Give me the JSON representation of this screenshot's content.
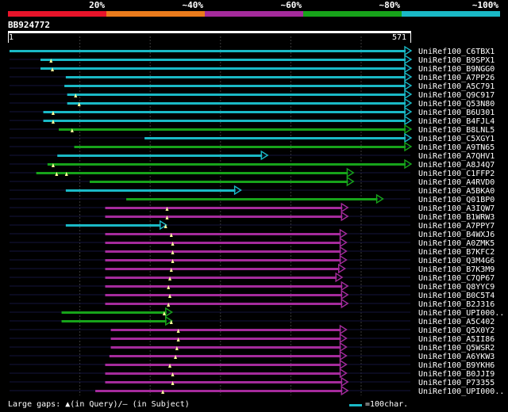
{
  "legend": {
    "segments": [
      {
        "color": "#e8142a",
        "label": "20%"
      },
      {
        "color": "#ea7b1c",
        "label": "~40%"
      },
      {
        "color": "#a52b9c",
        "label": "~60%"
      },
      {
        "color": "#17a31a",
        "label": "~80%"
      },
      {
        "color": "#1ab9c6",
        "label": "~100%"
      }
    ]
  },
  "query": {
    "id": "BB924772",
    "start": "1",
    "end": "571",
    "length": 571
  },
  "colors": {
    "cyan": "#1ab9c6",
    "green": "#17a31a",
    "magenta": "#a52b9c",
    "row_guide": "#14143c",
    "grid": "#3c3c3c",
    "gap_marker": "#ffff99"
  },
  "hits": [
    {
      "name": "UniRef100_C6TBX1",
      "start": 1,
      "end": 571,
      "color": "cyan",
      "markers": []
    },
    {
      "name": "UniRef100_B9SPX1",
      "start": 45,
      "end": 571,
      "color": "cyan",
      "markers": [
        60
      ]
    },
    {
      "name": "UniRef100_B9NGG0",
      "start": 45,
      "end": 571,
      "color": "cyan",
      "markers": [
        62
      ]
    },
    {
      "name": "UniRef100_A7PP26",
      "start": 81,
      "end": 571,
      "color": "cyan",
      "markers": []
    },
    {
      "name": "UniRef100_A5C791",
      "start": 79,
      "end": 571,
      "color": "cyan",
      "markers": []
    },
    {
      "name": "UniRef100_Q9C917",
      "start": 83,
      "end": 571,
      "color": "cyan",
      "markers": [
        95
      ]
    },
    {
      "name": "UniRef100_Q53N80",
      "start": 83,
      "end": 571,
      "color": "cyan",
      "markers": [
        100
      ]
    },
    {
      "name": "UniRef100_B6U301",
      "start": 49,
      "end": 571,
      "color": "cyan",
      "markers": [
        63
      ]
    },
    {
      "name": "UniRef100_B4FJL4",
      "start": 49,
      "end": 571,
      "color": "cyan",
      "markers": [
        63
      ]
    },
    {
      "name": "UniRef100_B8LNL5",
      "start": 71,
      "end": 571,
      "color": "green",
      "markers": [
        90
      ]
    },
    {
      "name": "UniRef100_C5XGY1",
      "start": 193,
      "end": 571,
      "color": "cyan",
      "markers": []
    },
    {
      "name": "UniRef100_A9TN65",
      "start": 93,
      "end": 571,
      "color": "green",
      "markers": []
    },
    {
      "name": "UniRef100_A7QHV1",
      "start": 69,
      "end": 367,
      "color": "cyan",
      "markers": []
    },
    {
      "name": "UniRef100_A8J4Q7",
      "start": 55,
      "end": 571,
      "color": "green",
      "markers": [
        63
      ]
    },
    {
      "name": "UniRef100_C1FFP2",
      "start": 39,
      "end": 489,
      "color": "green",
      "markers": [
        68,
        82
      ]
    },
    {
      "name": "UniRef100_A4RVD0",
      "start": 115,
      "end": 489,
      "color": "green",
      "markers": []
    },
    {
      "name": "UniRef100_A5BKA0",
      "start": 81,
      "end": 329,
      "color": "cyan",
      "markers": []
    },
    {
      "name": "UniRef100_Q01BP0",
      "start": 167,
      "end": 531,
      "color": "green",
      "markers": []
    },
    {
      "name": "UniRef100_A3IQW7",
      "start": 137,
      "end": 481,
      "color": "magenta",
      "markers": [
        225
      ]
    },
    {
      "name": "UniRef100_B1WRW3",
      "start": 137,
      "end": 481,
      "color": "magenta",
      "markers": [
        225
      ]
    },
    {
      "name": "UniRef100_A7PPY7",
      "start": 81,
      "end": 223,
      "color": "cyan",
      "markers": [
        223
      ]
    },
    {
      "name": "UniRef100_B4WXJ6",
      "start": 137,
      "end": 479,
      "color": "magenta",
      "markers": [
        231
      ]
    },
    {
      "name": "UniRef100_A0ZMK5",
      "start": 137,
      "end": 479,
      "color": "magenta",
      "markers": [
        233
      ]
    },
    {
      "name": "UniRef100_B7KFC2",
      "start": 137,
      "end": 479,
      "color": "magenta",
      "markers": [
        233
      ]
    },
    {
      "name": "UniRef100_Q3M4G6",
      "start": 137,
      "end": 479,
      "color": "magenta",
      "markers": [
        233
      ]
    },
    {
      "name": "UniRef100_B7K3M9",
      "start": 137,
      "end": 477,
      "color": "magenta",
      "markers": [
        231
      ]
    },
    {
      "name": "UniRef100_C7QP67",
      "start": 137,
      "end": 473,
      "color": "magenta",
      "markers": [
        229
      ]
    },
    {
      "name": "UniRef100_Q8YYC9",
      "start": 137,
      "end": 481,
      "color": "magenta",
      "markers": [
        227
      ]
    },
    {
      "name": "UniRef100_B0C5T4",
      "start": 137,
      "end": 481,
      "color": "magenta",
      "markers": [
        229
      ]
    },
    {
      "name": "UniRef100_B2J316",
      "start": 137,
      "end": 481,
      "color": "magenta",
      "markers": [
        227
      ]
    },
    {
      "name": "UniRef100_UPI000..",
      "start": 75,
      "end": 231,
      "color": "green",
      "markers": [
        221
      ]
    },
    {
      "name": "UniRef100_A5C402",
      "start": 75,
      "end": 231,
      "color": "green",
      "markers": [
        231
      ]
    },
    {
      "name": "UniRef100_Q5X0Y2",
      "start": 145,
      "end": 479,
      "color": "magenta",
      "markers": [
        241
      ]
    },
    {
      "name": "UniRef100_A5II86",
      "start": 145,
      "end": 479,
      "color": "magenta",
      "markers": [
        241
      ]
    },
    {
      "name": "UniRef100_Q5WSR2",
      "start": 145,
      "end": 479,
      "color": "magenta",
      "markers": [
        239
      ]
    },
    {
      "name": "UniRef100_A6YKW3",
      "start": 143,
      "end": 479,
      "color": "magenta",
      "markers": [
        237
      ]
    },
    {
      "name": "UniRef100_B9YKH6",
      "start": 137,
      "end": 479,
      "color": "magenta",
      "markers": [
        229
      ]
    },
    {
      "name": "UniRef100_B0JJI9",
      "start": 137,
      "end": 479,
      "color": "magenta",
      "markers": [
        233
      ]
    },
    {
      "name": "UniRef100_P73355",
      "start": 137,
      "end": 481,
      "color": "magenta",
      "markers": [
        233
      ]
    },
    {
      "name": "UniRef100_UPI000..",
      "start": 123,
      "end": 481,
      "color": "magenta",
      "markers": [
        219
      ]
    }
  ],
  "footer": {
    "large_gaps_prefix": "Large gaps: ",
    "query_marker": "▲",
    "query_text": "(in Query)/",
    "subject_marker": "—",
    "subject_text": " (in Subject)",
    "scale_text": "=100char."
  }
}
